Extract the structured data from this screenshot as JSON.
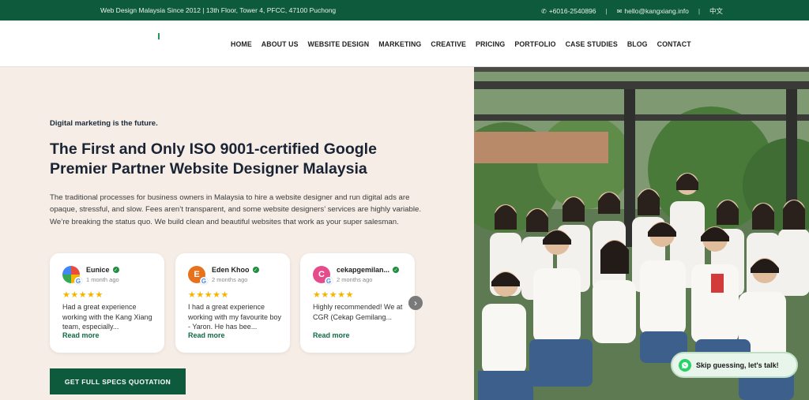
{
  "topbar": {
    "tagline": "Web Design Malaysia Since 2012 | 13th Floor, Tower 4, PFCC, 47100 Puchong",
    "phone": "+6016-2540896",
    "email": "hello@kangxiang.info",
    "language": "中文"
  },
  "nav": {
    "items": [
      "HOME",
      "ABOUT US",
      "WEBSITE DESIGN",
      "MARKETING",
      "CREATIVE",
      "PRICING",
      "PORTFOLIO",
      "CASE STUDIES",
      "BLOG",
      "CONTACT"
    ]
  },
  "hero": {
    "eyebrow": "Digital marketing is the future.",
    "headline": "The First and Only ISO 9001-certified Google Premier Partner Website Designer Malaysia",
    "description": "The traditional processes for business owners in Malaysia to hire a website designer and run digital ads are opaque, stressful, and slow. Fees aren’t transparent, and some website designers’ services are highly variable. We’re breaking the status quo. We build clean and beautiful websites that work as your super salesman.",
    "cta": "GET FULL SPECS QUOTATION"
  },
  "reviews": [
    {
      "name": "Eunice",
      "date": "1 month ago",
      "stars": "★★★★★",
      "rating": 5,
      "text": "Had a great experience working with the Kang Xiang team, especially...",
      "read_more": "Read more",
      "initial": "",
      "avatar_color": "#e8a33c"
    },
    {
      "name": "Eden Khoo",
      "date": "2 months ago",
      "stars": "★★★★★",
      "rating": 5,
      "text": "I had a great experience working with my favourite boy - Yaron. He has bee...",
      "read_more": "Read more",
      "initial": "E",
      "avatar_color": "#e8711c"
    },
    {
      "name": "cekapgemilan...",
      "date": "2 months ago",
      "stars": "★★★★★",
      "rating": 5,
      "text": "Highly recommended! We at CGR (Cekap Gemilang...",
      "read_more": "Read more",
      "initial": "C",
      "avatar_color": "#e64b8c"
    }
  ],
  "chat": {
    "label": "Skip guessing, let's talk!"
  },
  "colors": {
    "brand_green": "#0e5a3c",
    "star": "#f5b400",
    "background": "#f5ede6"
  },
  "icons": [
    "whatsapp-icon",
    "mail-icon",
    "verified-icon",
    "google-icon",
    "chevron-right-icon"
  ]
}
